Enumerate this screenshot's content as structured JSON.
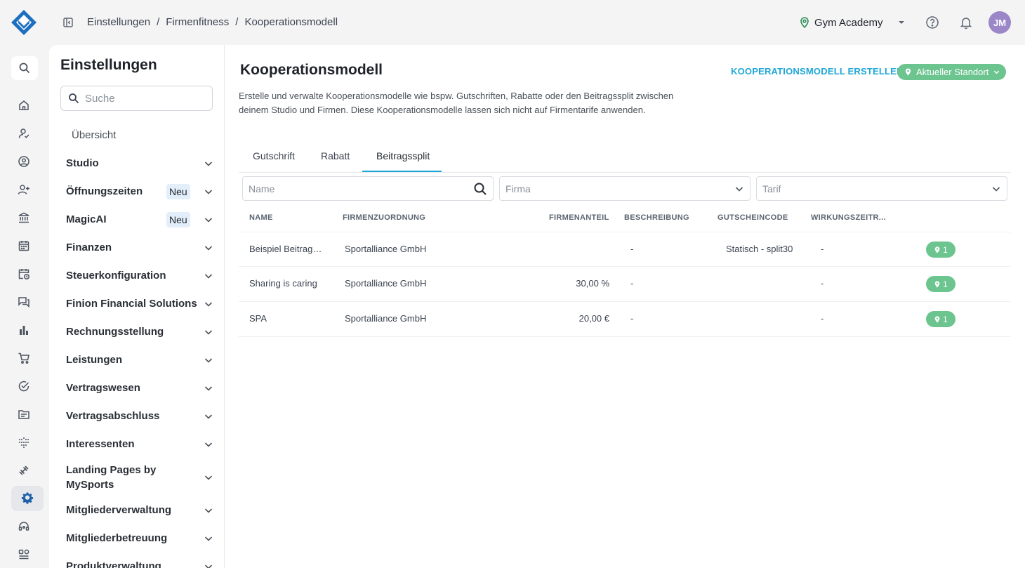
{
  "breadcrumb": [
    "Einstellungen",
    "Firmenfitness",
    "Kooperationsmodell"
  ],
  "breadcrumb_sep": "/",
  "studio": {
    "name": "Gym Academy"
  },
  "user": {
    "initials": "JM",
    "avatar_color": "#9b86c8"
  },
  "colors": {
    "accent": "#1fa7d6",
    "location_green": "#6cc48f",
    "brand": "#1d5fa8"
  },
  "rail": {
    "icons": [
      "search-icon",
      "home-icon",
      "user-check-icon",
      "account-circle-icon",
      "user-add-icon",
      "bank-icon",
      "calendar-icon",
      "calendar-clock-icon",
      "chat-icon",
      "bar-chart-icon",
      "cart-icon",
      "check-circle-icon",
      "folder-icon",
      "dots-grid-icon",
      "dumbbell-icon",
      "gear-icon",
      "headset-icon",
      "apps-icon"
    ],
    "active": "gear-icon"
  },
  "sidebar": {
    "title": "Einstellungen",
    "search_placeholder": "Suche",
    "overview": "Übersicht",
    "items": [
      {
        "label": "Studio"
      },
      {
        "label": "Öffnungszeiten",
        "badge": "Neu"
      },
      {
        "label": "MagicAI",
        "badge": "Neu"
      },
      {
        "label": "Finanzen"
      },
      {
        "label": "Steuerkonfiguration"
      },
      {
        "label": "Finion Financial Solutions"
      },
      {
        "label": "Rechnungsstellung"
      },
      {
        "label": "Leistungen"
      },
      {
        "label": "Vertragswesen"
      },
      {
        "label": "Vertragsabschluss"
      },
      {
        "label": "Interessenten"
      },
      {
        "label": "Landing Pages by MySports"
      },
      {
        "label": "Mitgliederverwaltung"
      },
      {
        "label": "Mitgliederbetreuung"
      },
      {
        "label": "Produktverwaltung"
      }
    ]
  },
  "main": {
    "title": "Kooperationsmodell",
    "create_label": "KOOPERATIONSMODELL ERSTELLEN",
    "location_label": "Aktueller Standort",
    "description": "Erstelle und verwalte Kooperationsmodelle wie bspw. Gutschriften, Rabatte oder den Beitragssplit zwischen deinem Studio und Firmen. Diese Kooperationsmodelle lassen sich nicht auf Firmentarife anwenden.",
    "tabs": [
      "Gutschrift",
      "Rabatt",
      "Beitragssplit"
    ],
    "active_tab": "Beitragssplit",
    "filters": {
      "name_placeholder": "Name",
      "firma_placeholder": "Firma",
      "tarif_placeholder": "Tarif"
    },
    "columns": [
      "NAME",
      "FIRMENZUORDNUNG",
      "FIRMENANTEIL",
      "BESCHREIBUNG",
      "GUTSCHEINCODE",
      "WIRKUNGSZEITR..."
    ],
    "rows": [
      {
        "name": "Beispiel Beitrag…",
        "firma": "Sportalliance GmbH",
        "anteil": "",
        "beschreibung": "-",
        "code": "Statisch - split30",
        "zeitraum": "-",
        "locations": "1"
      },
      {
        "name": "Sharing is caring",
        "firma": "Sportalliance GmbH",
        "anteil": "30,00 %",
        "beschreibung": "-",
        "code": "",
        "zeitraum": "-",
        "locations": "1"
      },
      {
        "name": "SPA",
        "firma": "Sportalliance GmbH",
        "anteil": "20,00 €",
        "beschreibung": "-",
        "code": "",
        "zeitraum": "-",
        "locations": "1"
      }
    ]
  }
}
